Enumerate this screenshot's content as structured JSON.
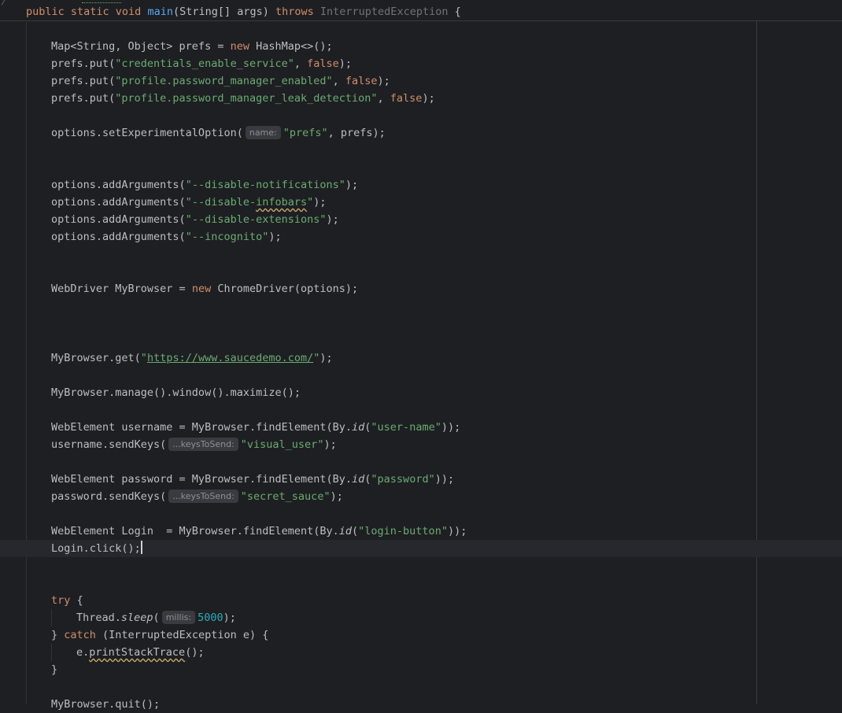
{
  "lines": {
    "sig": {
      "p1": "public static void ",
      "p2": "main",
      "p3": "(String[] args) ",
      "p4": "throws ",
      "p5": "InterruptedException",
      "p6": " {"
    },
    "l1": {
      "p1": "Map<String, Object> prefs = ",
      "p2": "new ",
      "p3": "HashMap<>();"
    },
    "l2": {
      "p1": "prefs.put(",
      "p2": "\"credentials_enable_service\"",
      "p3": ", ",
      "p4": "false",
      "p5": ");"
    },
    "l3": {
      "p1": "prefs.put(",
      "p2": "\"profile.password_manager_enabled\"",
      "p3": ", ",
      "p4": "false",
      "p5": ");"
    },
    "l4": {
      "p1": "prefs.put(",
      "p2": "\"profile.password_manager_leak_detection\"",
      "p3": ", ",
      "p4": "false",
      "p5": ");"
    },
    "l5": {
      "p1": "options.setExperimentalOption(",
      "hint": "name:",
      "p2": "\"prefs\"",
      "p3": ", prefs);"
    },
    "l6": {
      "p1": "options.addArguments(",
      "p2": "\"--disable-notifications\"",
      "p3": ");"
    },
    "l7": {
      "p1": "options.addArguments(",
      "p2": "\"--disable-",
      "p3": "infobars",
      "p4": "\"",
      "p5": ");"
    },
    "l8": {
      "p1": "options.addArguments(",
      "p2": "\"--disable-extensions\"",
      "p3": ");"
    },
    "l9": {
      "p1": "options.addArguments(",
      "p2": "\"--incognito\"",
      "p3": ");"
    },
    "l10": {
      "p1": "WebDriver MyBrowser = ",
      "p2": "new ",
      "p3": "ChromeDriver(options);"
    },
    "l11": {
      "p1": "MyBrowser.get(",
      "p2": "\"",
      "p3": "https://www.saucedemo.com/",
      "p4": "\"",
      "p5": ");"
    },
    "l12": {
      "p1": "MyBrowser.manage().window().maximize();"
    },
    "l13": {
      "p1": "WebElement username = MyBrowser.findElement(By.",
      "p2": "id",
      "p3": "(",
      "p4": "\"user-name\"",
      "p5": "));"
    },
    "l14": {
      "p1": "username.sendKeys(",
      "hint": "...keysToSend:",
      "p2": "\"visual_user\"",
      "p3": ");"
    },
    "l15": {
      "p1": "WebElement password = MyBrowser.findElement(By.",
      "p2": "id",
      "p3": "(",
      "p4": "\"password\"",
      "p5": "));"
    },
    "l16": {
      "p1": "password.sendKeys(",
      "hint": "...keysToSend:",
      "p2": "\"secret_sauce\"",
      "p3": ");"
    },
    "l17": {
      "p1": "WebElement Login  = MyBrowser.findElement(By.",
      "p2": "id",
      "p3": "(",
      "p4": "\"login-button\"",
      "p5": "));"
    },
    "l18": {
      "p1": "Login.click();"
    },
    "l19": {
      "p1": "try",
      "p2": " {"
    },
    "l20": {
      "p1": "Thread.",
      "p2": "sleep",
      "p3": "(",
      "hint": "millis:",
      "p4": "5000",
      "p5": ");"
    },
    "l21": {
      "p1": "} ",
      "p2": "catch",
      "p3": " (InterruptedException e) {"
    },
    "l22": {
      "p1": "e.",
      "p2": "printStackTrace",
      "p3": "();"
    },
    "l23": {
      "p1": "}"
    },
    "l24": {
      "p1": "MyBrowser.quit();"
    }
  }
}
